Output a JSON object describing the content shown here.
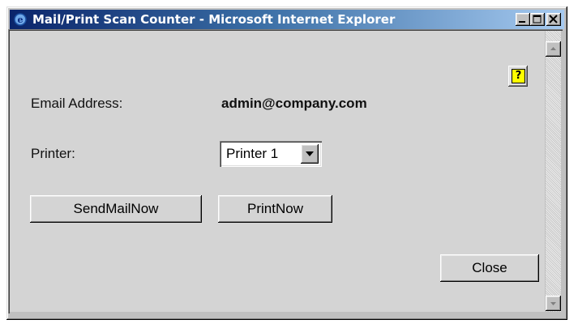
{
  "window": {
    "title": "Mail/Print Scan Counter - Microsoft Internet Explorer",
    "icon": "internet-explorer-icon",
    "controls": [
      "minimize-icon",
      "maximize-icon",
      "close-icon"
    ]
  },
  "help": {
    "icon": "help-icon",
    "glyph": "?"
  },
  "form": {
    "email_label": "Email Address:",
    "email_value": "admin@company.com",
    "printer_label": "Printer:",
    "printer_selected": "Printer 1"
  },
  "buttons": {
    "send_mail": "SendMailNow",
    "print": "PrintNow",
    "close": "Close"
  },
  "colors": {
    "titlebar_start": "#0a246a",
    "titlebar_end": "#a6caf0",
    "help_yellow": "#ffff00",
    "face": "#d4d4d4"
  }
}
